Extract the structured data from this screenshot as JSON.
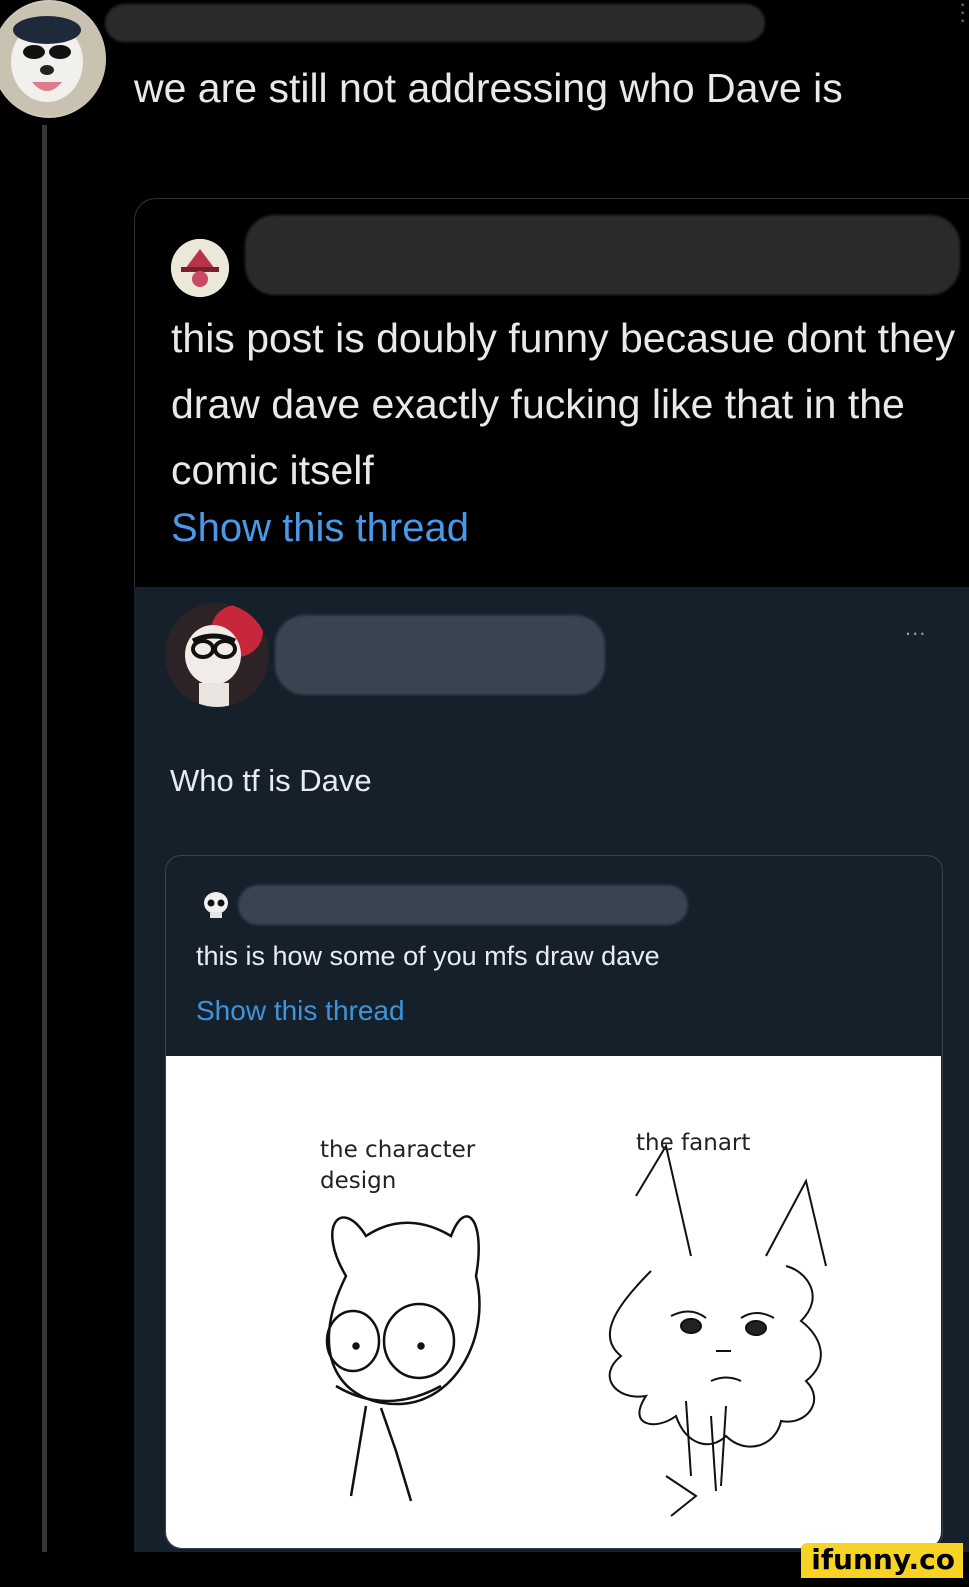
{
  "tweet": {
    "text": "we are still not addressing who Dave is"
  },
  "quoted_tweet": {
    "text": "this post is doubly funny becasue dont they draw dave exactly fucking like that in the comic itself",
    "show_thread": "Show this thread"
  },
  "screenshot": {
    "text": "Who tf is Dave",
    "more": "...",
    "inner_quote": {
      "text": "this is how some of you mfs draw dave",
      "show_thread": "Show this thread"
    },
    "drawing": {
      "left_label": "the character design",
      "right_label": "the fanart"
    }
  },
  "watermark": "ifunny.co",
  "colors": {
    "background": "#000000",
    "link": "#4a99e9",
    "dim_panel": "#15202b",
    "watermark_bg": "#f7d423"
  }
}
